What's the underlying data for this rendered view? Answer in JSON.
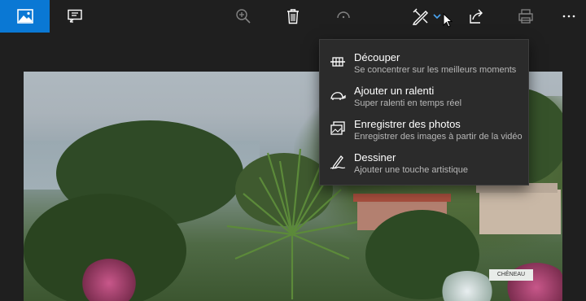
{
  "toolbar": {
    "buttons": [
      {
        "id": "app",
        "icon": "photos-app-icon"
      },
      {
        "id": "slideshow",
        "icon": "slideshow-icon"
      },
      {
        "id": "zoom",
        "icon": "zoom-in-icon"
      },
      {
        "id": "delete",
        "icon": "trash-icon"
      },
      {
        "id": "rotate",
        "icon": "rotate-icon"
      },
      {
        "id": "edit",
        "icon": "edit-create-icon"
      },
      {
        "id": "share",
        "icon": "share-icon"
      },
      {
        "id": "print",
        "icon": "print-icon"
      },
      {
        "id": "more",
        "icon": "more-icon"
      }
    ]
  },
  "menu": {
    "items": [
      {
        "title": "Découper",
        "subtitle": "Se concentrer sur les meilleurs moments",
        "icon": "trim-icon"
      },
      {
        "title": "Ajouter un ralenti",
        "subtitle": "Super ralenti en temps réel",
        "icon": "slow-motion-icon"
      },
      {
        "title": "Enregistrer des photos",
        "subtitle": "Enregistrer des images à partir de la vidéo",
        "icon": "save-photos-icon"
      },
      {
        "title": "Dessiner",
        "subtitle": "Ajouter une touche artistique",
        "icon": "draw-icon"
      }
    ]
  },
  "sign": {
    "text": "CHÊNEAU"
  },
  "colors": {
    "accent": "#0a78d4",
    "menu_bg": "#2b2b2b",
    "toolbar_bg": "#1f1f1f"
  }
}
